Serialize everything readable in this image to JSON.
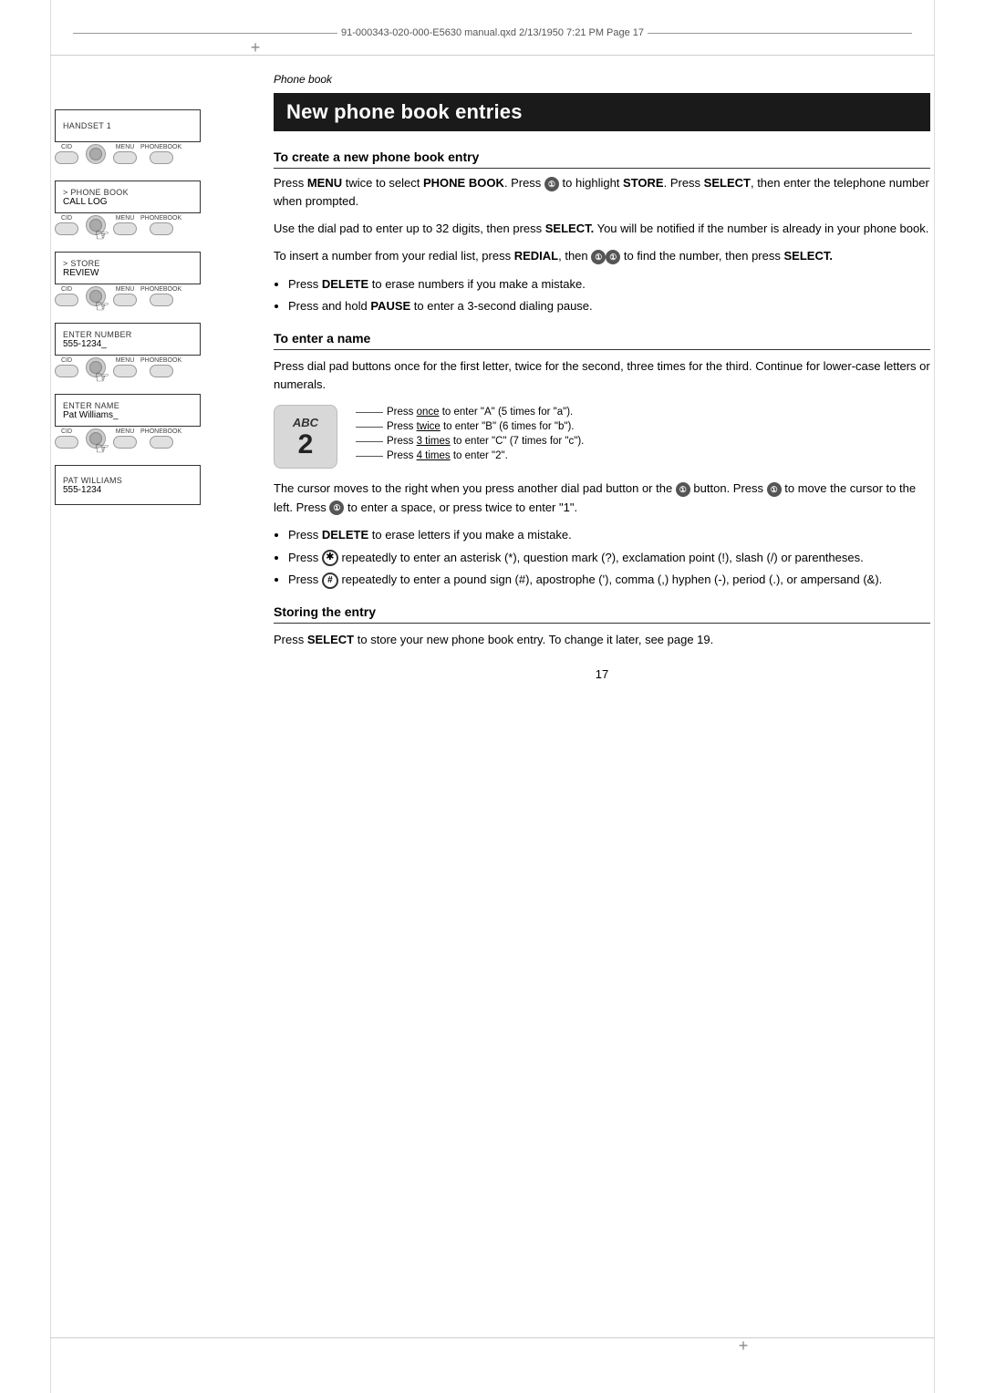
{
  "header": {
    "file_info": "91-000343-020-000-E5630 manual.qxd  2/13/1950  7:21 PM  Page 17"
  },
  "page_category": "Phone book",
  "page_title": "New phone book entries",
  "sections": {
    "create_entry": {
      "heading": "To create a new phone book entry",
      "para1": "Press MENU twice to select PHONE BOOK. Press ❶ to highlight STORE. Press SELECT, then enter the telephone number when prompted.",
      "para2": "Use the dial pad to enter up to 32 digits, then press SELECT. You will be notified if the number is already in your phone book.",
      "para3": "To insert a number from your redial list, press REDIAL, then ❶❶ to find the number, then press SELECT.",
      "bullets": [
        "Press DELETE to erase numbers if you make a mistake.",
        "Press and hold PAUSE to enter a 3-second dialing pause."
      ]
    },
    "enter_name": {
      "heading": "To enter a name",
      "para1": "Press dial pad buttons once for the first letter, twice for the second, three times for the third. Continue for lower-case letters or numerals.",
      "abc_lines": [
        "Press once to enter \"A\" (5 times for \"a\").",
        "Press twice to enter \"B\" (6 times for \"b\").",
        "Press 3 times to enter \"C\" (7 times for \"c\").",
        "Press 4 times to enter \"2\"."
      ],
      "abc_label": "ABC",
      "abc_number": "2",
      "para2": "The cursor moves to the right when you press another dial pad button or the ❶ button. Press ❶ to move the cursor to the left. Press ❶ to enter a space, or press twice to enter \"1\".",
      "bullets2": [
        "Press DELETE to erase letters if you make a mistake.",
        "Press ✱ repeatedly to enter an asterisk (*), question mark (?), exclamation point (!), slash (/) or parentheses.",
        "Press # repeatedly to enter a pound sign (#), apostrophe ('), comma (,) hyphen (-), period (.), or ampersand (&)."
      ]
    },
    "storing": {
      "heading": "Storing the entry",
      "para": "Press SELECT to store your new phone book entry. To change it later, see page 19."
    }
  },
  "device_diagrams": [
    {
      "screen_label": "HANDSET 1",
      "screen_value": "",
      "has_hand": false,
      "button_labels": [
        "CID",
        "MENU",
        "PHONEBOOK"
      ]
    },
    {
      "screen_label": "> PHONE BOOK",
      "screen_value": "CALL LOG",
      "has_hand": true,
      "button_labels": [
        "CID",
        "MENU",
        "PHONEBOOK"
      ]
    },
    {
      "screen_label": "> STORE",
      "screen_value": "REVIEW",
      "has_hand": true,
      "button_labels": [
        "CID",
        "MENU",
        "PHONEBOOK"
      ]
    },
    {
      "screen_label": "ENTER NUMBER",
      "screen_value": "555-1234_",
      "has_hand": true,
      "button_labels": [
        "CID",
        "MENU",
        "PHONEBOOK"
      ]
    },
    {
      "screen_label": "ENTER NAME",
      "screen_value": "Pat Williams_",
      "has_hand": true,
      "button_labels": [
        "CID",
        "MENU",
        "PHONEBOOK"
      ]
    },
    {
      "screen_label": "Pat Williams",
      "screen_value": "555-1234",
      "has_hand": false,
      "button_labels": []
    }
  ],
  "page_number": "17"
}
